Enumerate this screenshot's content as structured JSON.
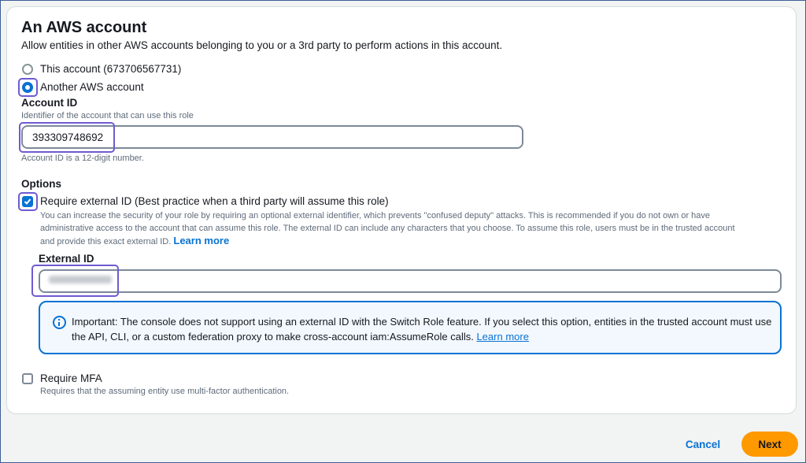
{
  "section": {
    "title": "An AWS account",
    "subtitle": "Allow entities in other AWS accounts belonging to you or a 3rd party to perform actions in this account."
  },
  "options": {
    "this_account": "This account (673706567731)",
    "another_account": "Another AWS account",
    "selected": "another_account"
  },
  "account_id": {
    "label": "Account ID",
    "description": "Identifier of the account that can use this role",
    "value": "393309748692",
    "constraint": "Account ID is a 12-digit number."
  },
  "options_section": {
    "heading": "Options",
    "require_external_id": {
      "label": "Require external ID (Best practice when a third party will assume this role)",
      "checked": true,
      "description_line1": "You can increase the security of your role by requiring an optional external identifier, which prevents \"confused deputy\" attacks. This is recommended if you do not own or have",
      "description_line2": "administrative access to the account that can assume this role. The external ID can include any characters that you choose. To assume this role, users must be in the trusted account",
      "description_line3": "and provide this exact external ID.",
      "learn_more": "Learn more"
    },
    "external_id": {
      "label": "External ID"
    },
    "alert": {
      "text": "Important: The console does not support using an external ID with the Switch Role feature. If you select this option, entities in the trusted account must use the API, CLI, or a custom federation proxy to make cross-account iam:AssumeRole calls.",
      "learn_more": "Learn more"
    },
    "require_mfa": {
      "label": "Require MFA",
      "checked": false,
      "description": "Requires that the assuming entity use multi-factor authentication."
    }
  },
  "footer": {
    "cancel": "Cancel",
    "next": "Next"
  },
  "colors": {
    "primary": "#0972d3",
    "next_button": "#ff9900",
    "highlight": "#6e5bd0"
  }
}
